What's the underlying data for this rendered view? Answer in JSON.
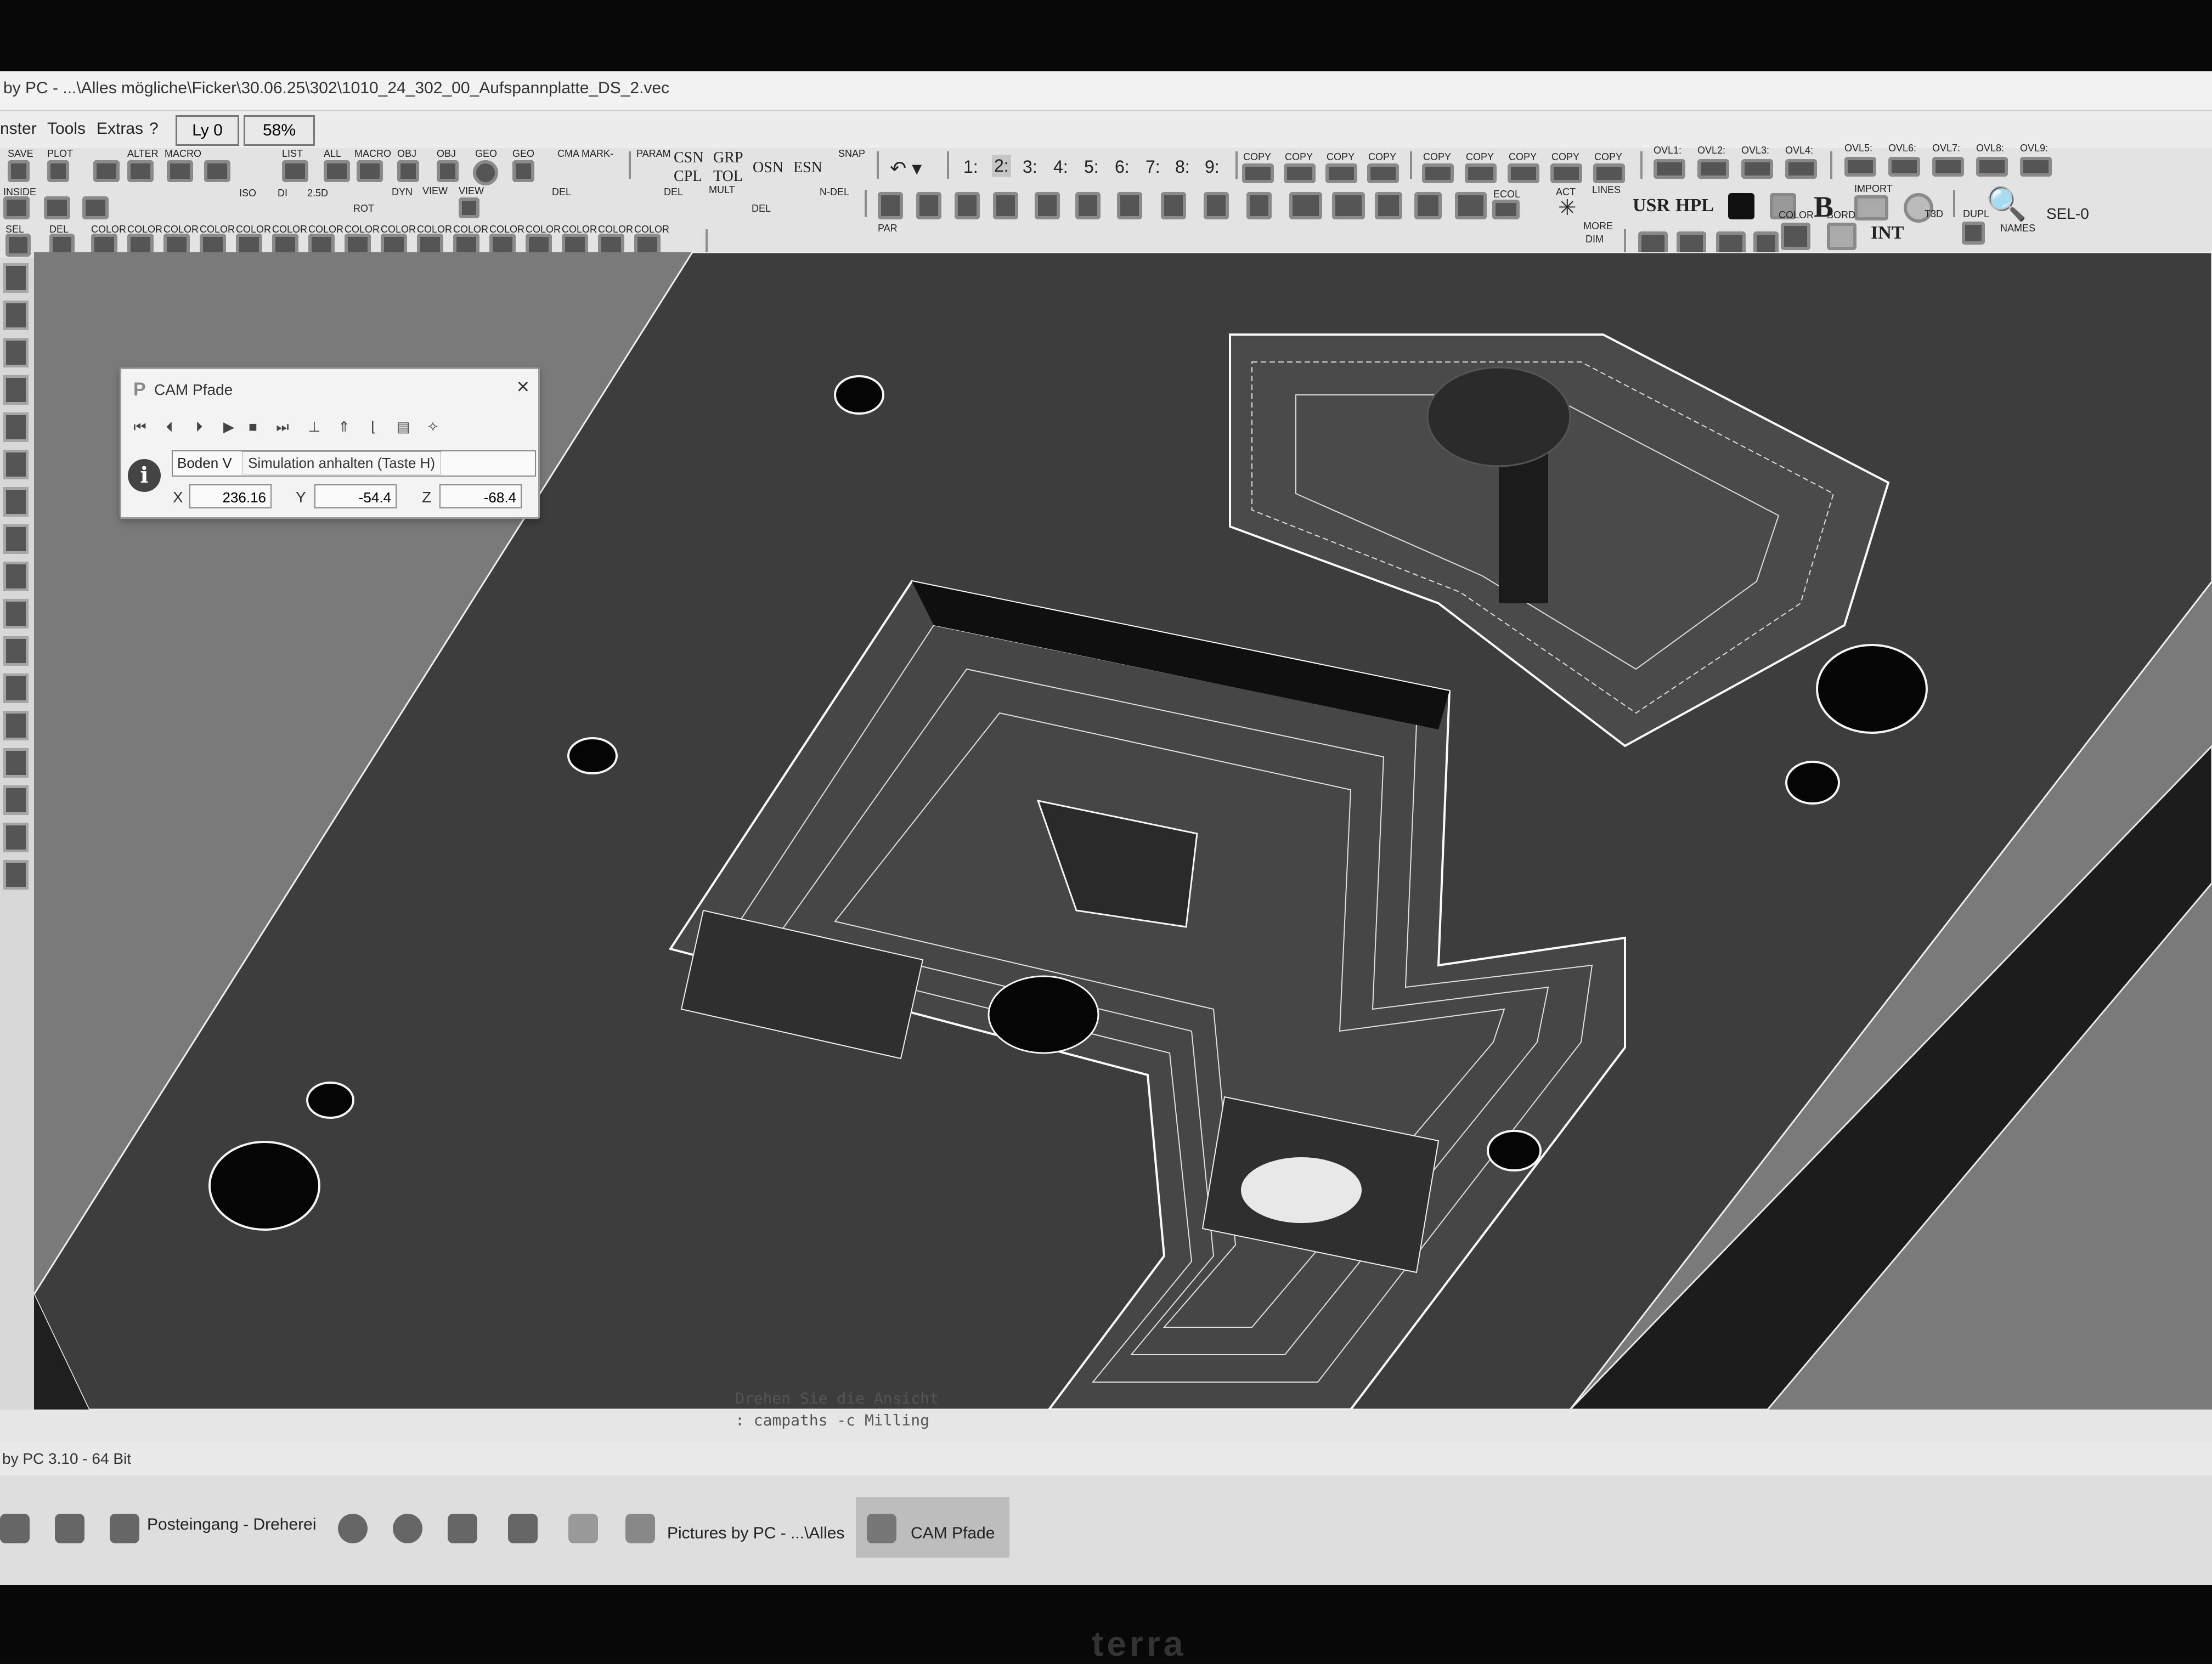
{
  "window": {
    "title": "by PC - ...\\Alles mögliche\\Ficker\\30.06.25\\302\\1010_24_302_00_Aufspannplatte_DS_2.vec"
  },
  "menu": {
    "items": [
      "nster",
      "Tools",
      "Extras",
      "?"
    ],
    "layer": "Ly 0",
    "zoom": "58%"
  },
  "toolbar": {
    "row1_labels": [
      "SAVE",
      "PLOT",
      "ALTER",
      "MACRO",
      "LIST",
      "ALL",
      "MACRO",
      "OBJ",
      "OBJ",
      "GEO",
      "GEO",
      "CMA",
      "MARK-",
      "PARAM",
      "CSN",
      "GRP",
      "CPL",
      "TOL",
      "OSN",
      "ESN",
      "SNAP"
    ],
    "row1_digits": [
      "1:",
      "2:",
      "3:",
      "4:",
      "5:",
      "6:",
      "7:",
      "8:",
      "9:"
    ],
    "copy_labels": [
      "COPY",
      "COPY",
      "COPY",
      "COPY",
      "COPY",
      "COPY",
      "COPY",
      "COPY",
      "COPY"
    ],
    "ovl_labels": [
      "OVL1:",
      "OVL2:",
      "OVL3:",
      "OVL4:",
      "OVL5:",
      "OVL6:",
      "OVL7:",
      "OVL8:",
      "OVL9:"
    ],
    "row2_labels": [
      "INSIDE",
      "ISO",
      "DI",
      "2.5D",
      "ROT",
      "DYN",
      "VIEW",
      "VIEW",
      "DEL",
      "DEL",
      "MULT",
      "DEL",
      "N-DEL",
      "ECOL",
      "ACT",
      "LINES",
      "USR",
      "HPL",
      "IMPORT"
    ],
    "row3_labels": [
      "SEL",
      "DEL",
      "COLOR",
      "COLOR",
      "COLOR",
      "COLOR",
      "COLOR",
      "COLOR",
      "COLOR",
      "COLOR",
      "COLOR",
      "COLOR",
      "COLOR",
      "COLOR",
      "COLOR",
      "COLOR",
      "COLOR",
      "COLOR",
      "PAR",
      "MORE",
      "DIM",
      "COLOR",
      "BORD",
      "INT",
      "T3D",
      "DUPL",
      "NAMES",
      "SEL-0"
    ]
  },
  "cam_panel": {
    "title": "CAM Pfade",
    "name_value": "Boden V",
    "tooltip": "Simulation anhalten (Taste H)",
    "x_label": "X",
    "y_label": "Y",
    "z_label": "Z",
    "x_value": "236.16",
    "y_value": "-54.4",
    "z_value": "-68.4",
    "controls": [
      "⏮",
      "⏴",
      "⏵",
      "▶",
      "■",
      "⏭"
    ]
  },
  "command": {
    "line1": "Drehen Sie die Ansicht",
    "line2": ": campaths -c Milling"
  },
  "status": {
    "version": "by PC 3.10 - 64 Bit"
  },
  "taskbar": {
    "apps": [
      "Posteingang - Dreherei",
      "Pictures by PC - ...\\Alles",
      "CAM Pfade"
    ]
  },
  "monitor_brand": "terra"
}
